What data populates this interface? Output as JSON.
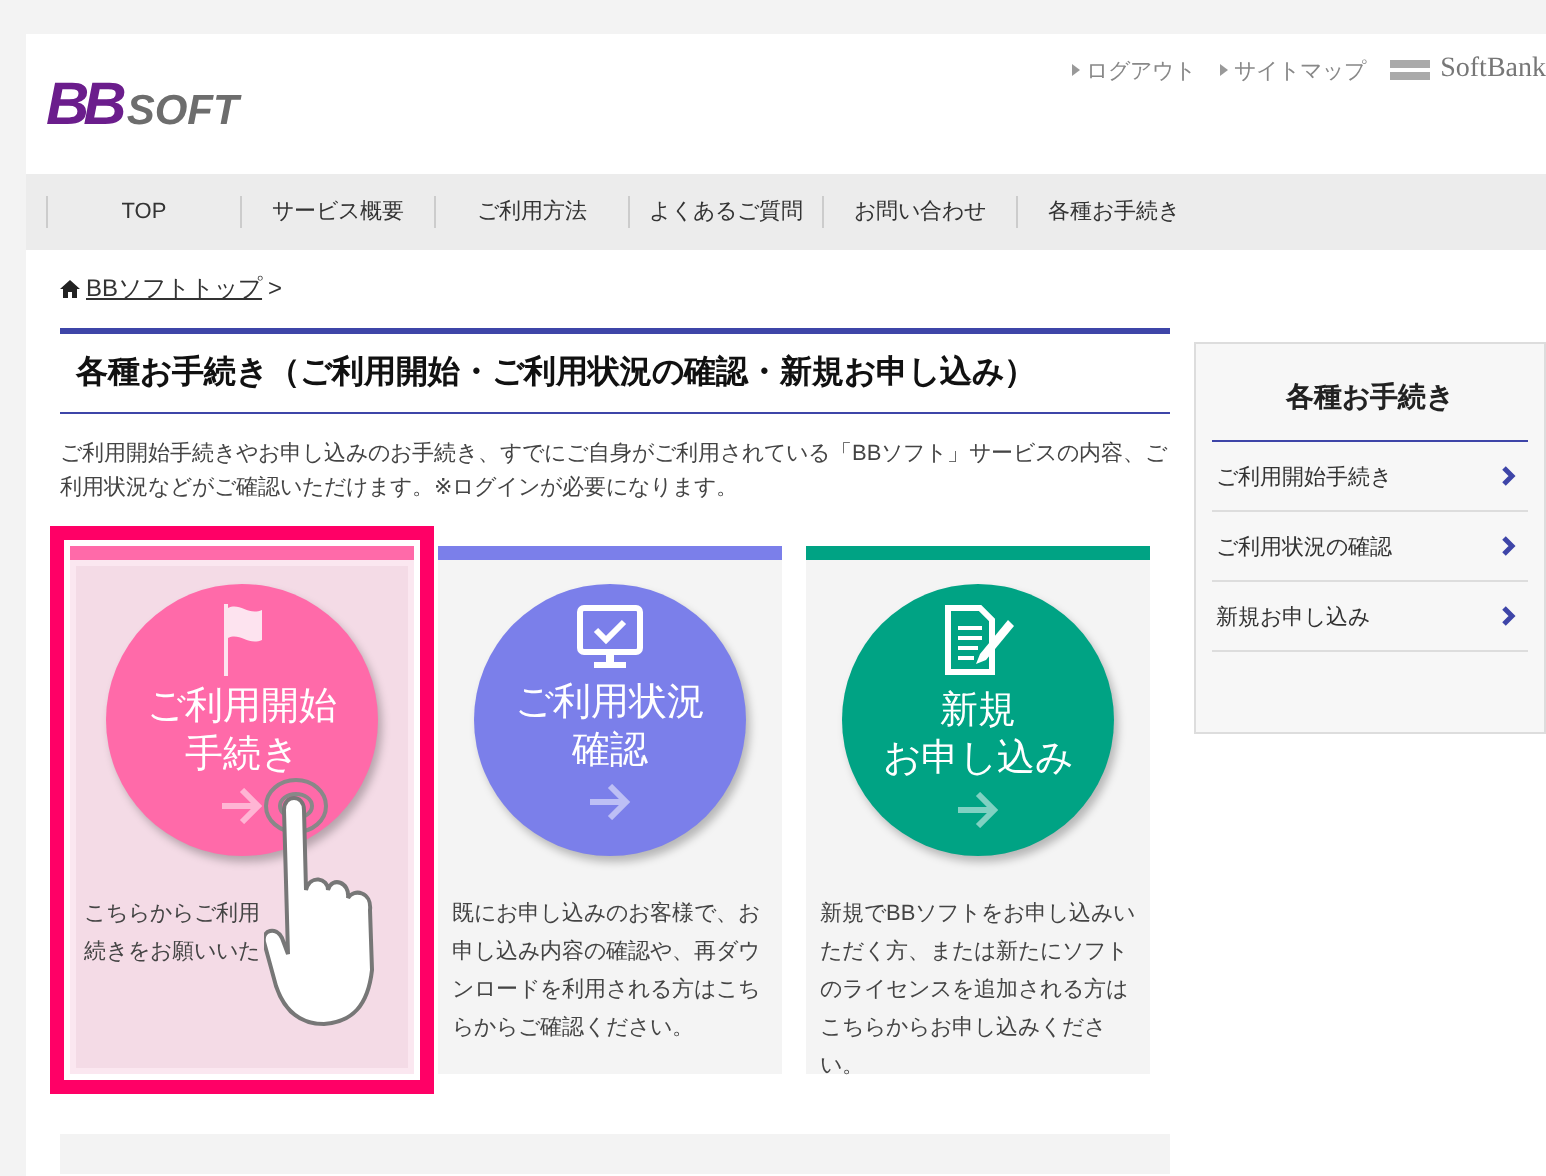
{
  "header": {
    "logo": {
      "mark": "BB",
      "word": "SOFT"
    },
    "links": [
      "ログアウト",
      "サイトマップ"
    ],
    "brand": "SoftBank"
  },
  "nav": [
    "TOP",
    "サービス概要",
    "ご利用方法",
    "よくあるご質問",
    "お問い合わせ",
    "各種お手続き"
  ],
  "breadcrumb": {
    "link": "BBソフトトップ",
    "separator": ">"
  },
  "title": "各種お手続き（ご利用開始・ご利用状況の確認・新規お申し込み）",
  "intro": "ご利用開始手続きやお申し込みのお手続き、すでにご自身がご利用されている「BBソフト」サービスの内容、ご利用状況などがご確認いただけます。※ログインが必要になります。",
  "cards": [
    {
      "kind": "flag",
      "color": "#ff6aa9",
      "highlighted": true,
      "title": [
        "ご利用開始",
        "手続き"
      ],
      "text": [
        "こちらからご利用",
        "続きをお願いいた"
      ]
    },
    {
      "kind": "monitor",
      "color": "#7b7fea",
      "highlighted": false,
      "title": [
        "ご利用状況",
        "確認"
      ],
      "text": [
        "既にお申し込みのお客様で、お申し込み内容の確認や、再ダウンロードを利用される方はこちらからご確認ください。"
      ]
    },
    {
      "kind": "document",
      "color": "#00a384",
      "highlighted": false,
      "title": [
        "新規",
        "お申し込み"
      ],
      "text": [
        "新規でBBソフトをお申し込みいただく方、または新たにソフトのライセンスを追加される方はこちらからお申し込みください。"
      ]
    }
  ],
  "sidebar": {
    "title": "各種お手続き",
    "items": [
      "ご利用開始手続き",
      "ご利用状況の確認",
      "新規お申し込み"
    ]
  }
}
